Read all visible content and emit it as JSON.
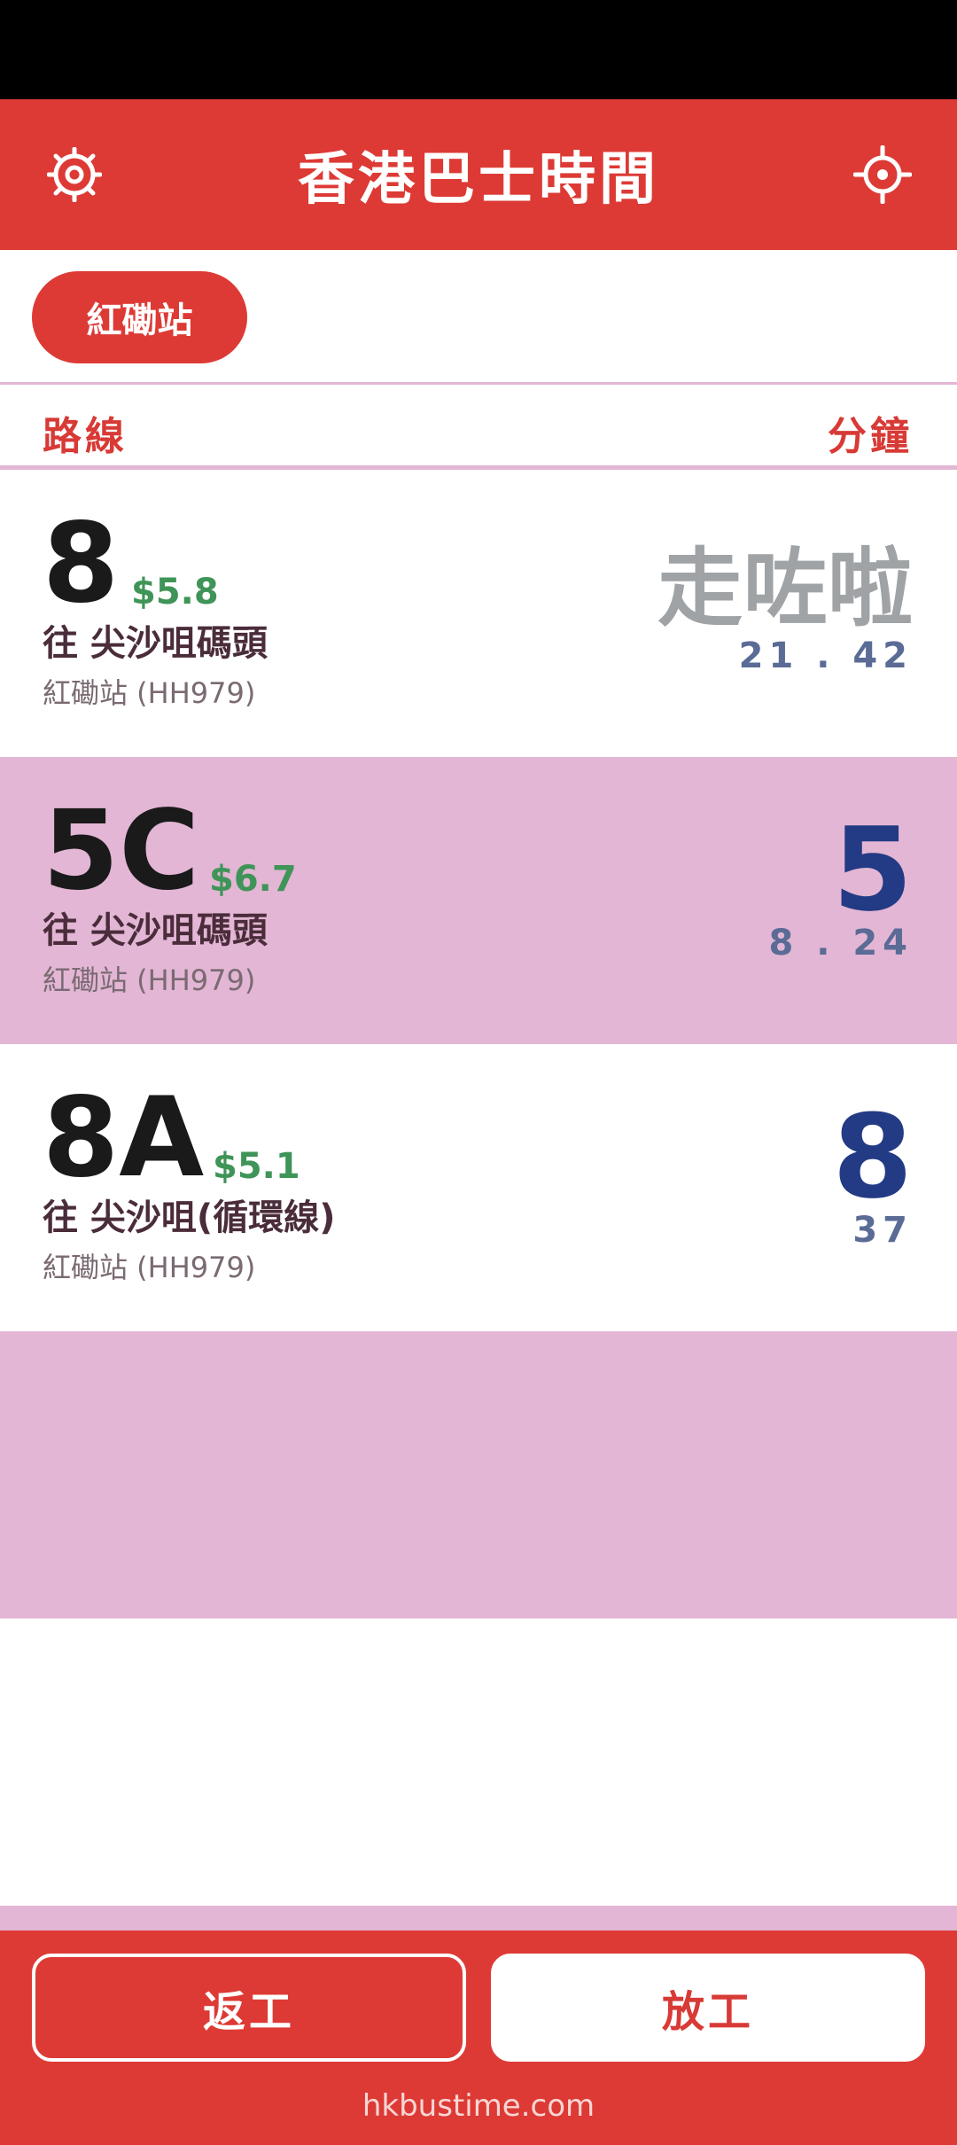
{
  "header": {
    "title": "香港巴士時間",
    "left_icon": "settings-gear-icon",
    "right_icon": "location-crosshair-icon"
  },
  "stop_selector": {
    "label": "紅磡站"
  },
  "columns": {
    "route": "路線",
    "minutes": "分鐘"
  },
  "routes": [
    {
      "number": "8",
      "fare": "$5.8",
      "destination": "往 尖沙咀碼頭",
      "stop": "紅磡站 (HH979)",
      "eta": "走咗啦",
      "eta_detail": "21 . 42"
    },
    {
      "number": "5C",
      "fare": "$6.7",
      "destination": "往 尖沙咀碼頭",
      "stop": "紅磡站 (HH979)",
      "eta": "5",
      "eta_detail": "8 . 24"
    },
    {
      "number": "8A",
      "fare": "$5.1",
      "destination": "往 尖沙咀(循環線)",
      "stop": "紅磡站 (HH979)",
      "eta": "8",
      "eta_detail": "37"
    }
  ],
  "bottom": {
    "to_work": "返工",
    "off_work": "放工",
    "footer": "hkbustime.com"
  },
  "colors": {
    "brand_red": "#dd3a35",
    "row_pink": "#e2b6d4",
    "fare_green": "#3f9457",
    "eta_blue": "#233a84",
    "departed_gray": "#a0a3a6"
  }
}
